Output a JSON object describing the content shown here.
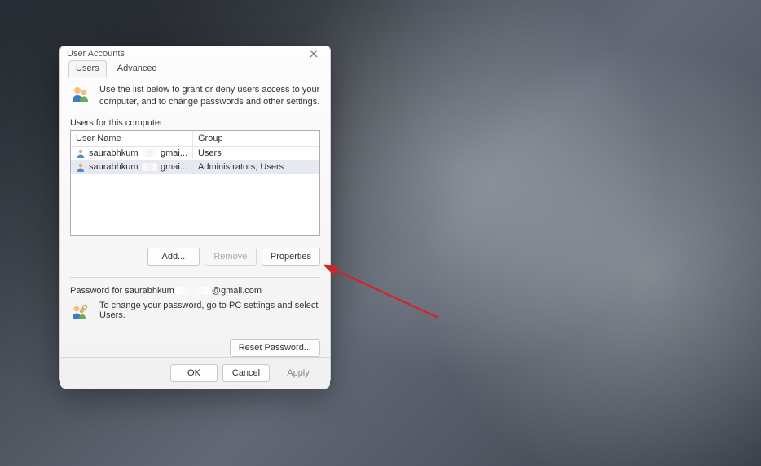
{
  "dialog": {
    "title": "User Accounts",
    "tabs": [
      {
        "label": "Users",
        "active": true
      },
      {
        "label": "Advanced",
        "active": false
      }
    ],
    "intro": "Use the list below to grant or deny users access to your computer, and to change passwords and other settings.",
    "list_label": "Users for this computer:",
    "columns": {
      "user": "User Name",
      "group": "Group"
    },
    "rows": [
      {
        "name_prefix": "saurabhkum",
        "name_suffix": "gmai...",
        "group": "Users",
        "selected": false
      },
      {
        "name_prefix": "saurabhkum",
        "name_suffix": "gmai...",
        "group": "Administrators; Users",
        "selected": true
      }
    ],
    "buttons": {
      "add": "Add...",
      "remove": "Remove",
      "properties": "Properties"
    },
    "password_for_prefix": "Password for saurabhkum",
    "password_for_suffix": "@gmail.com",
    "password_hint": "To change your password, go to PC settings and select Users.",
    "reset_btn": "Reset Password...",
    "footer": {
      "ok": "OK",
      "cancel": "Cancel",
      "apply": "Apply"
    }
  }
}
